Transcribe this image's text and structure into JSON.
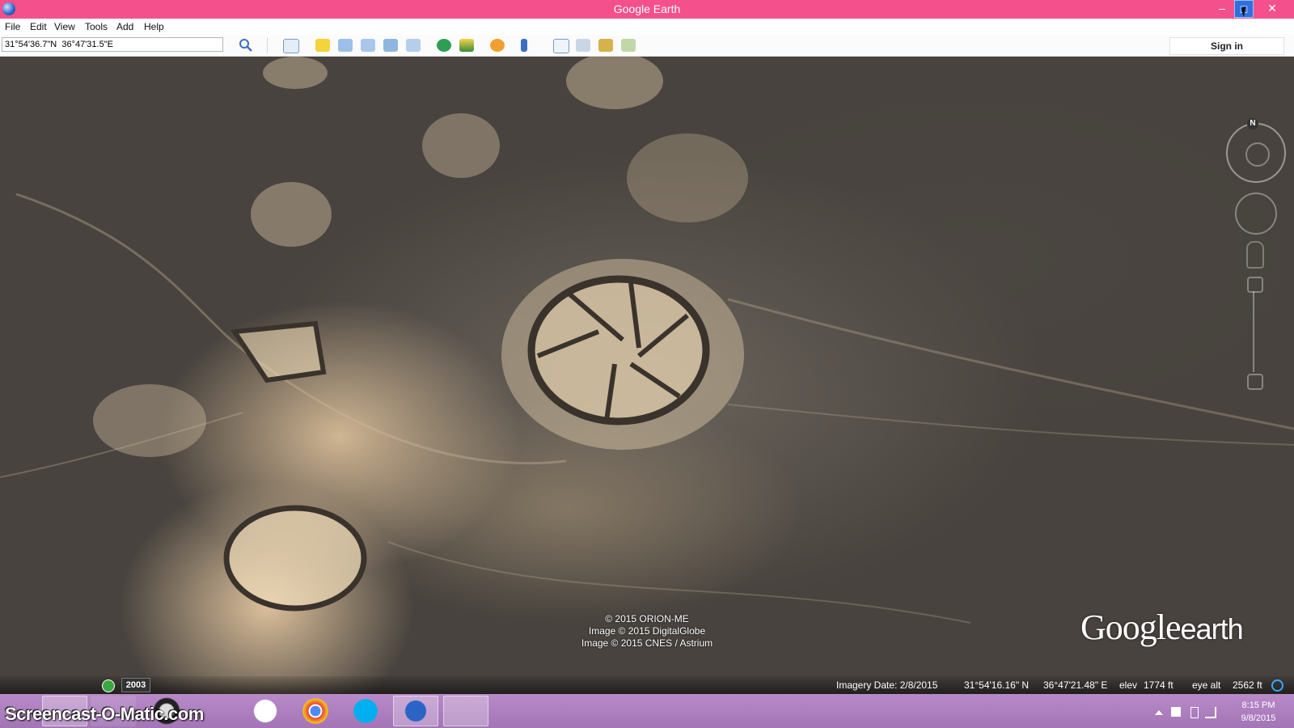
{
  "window": {
    "title": "Google Earth",
    "min_glyph": "–",
    "max_glyph": "□",
    "close_glyph": "✕",
    "titlebar_color": "#f4508c"
  },
  "menu": {
    "items": [
      "File",
      "Edit",
      "View",
      "Tools",
      "Add",
      "Help"
    ]
  },
  "toolbar": {
    "search_value": "31°54'36.7\"N  36°47'31.5\"E",
    "signin_label": "Sign in",
    "icons": [
      "sidebar-toggle-icon",
      "add-placemark-icon",
      "add-polygon-icon",
      "add-path-icon",
      "add-image-overlay-icon",
      "record-tour-icon",
      "historical-imagery-icon",
      "sunlight-icon",
      "planets-icon",
      "ruler-icon",
      "email-icon",
      "print-icon",
      "save-image-icon",
      "view-in-maps-icon"
    ]
  },
  "map": {
    "copyright_lines": [
      "© 2015 ORION-ME",
      "Image © 2015 DigitalGlobe",
      "Image © 2015 CNES / Astrium"
    ],
    "logo_main": "Google",
    "logo_sub": "earth",
    "north_label": "N"
  },
  "status": {
    "history_year": "2003",
    "imagery_date": "Imagery Date: 2/8/2015",
    "lat": "31°54'16.16\" N",
    "lon": "36°47'21.48\" E",
    "elev_label": "elev",
    "elev_value": "1774 ft",
    "eye_alt_label": "eye alt",
    "eye_alt_value": "2562 ft"
  },
  "taskbar": {
    "watermark": "Screencast-O-Matic.com",
    "time": "8:15 PM",
    "date": "9/8/2015",
    "apps": [
      "start-icon",
      "ie-icon",
      "file-explorer-icon",
      "webcam-icon",
      "hp-icon",
      "chrome-icon",
      "skype-icon",
      "google-earth-icon",
      "snipping-tool-icon"
    ]
  }
}
